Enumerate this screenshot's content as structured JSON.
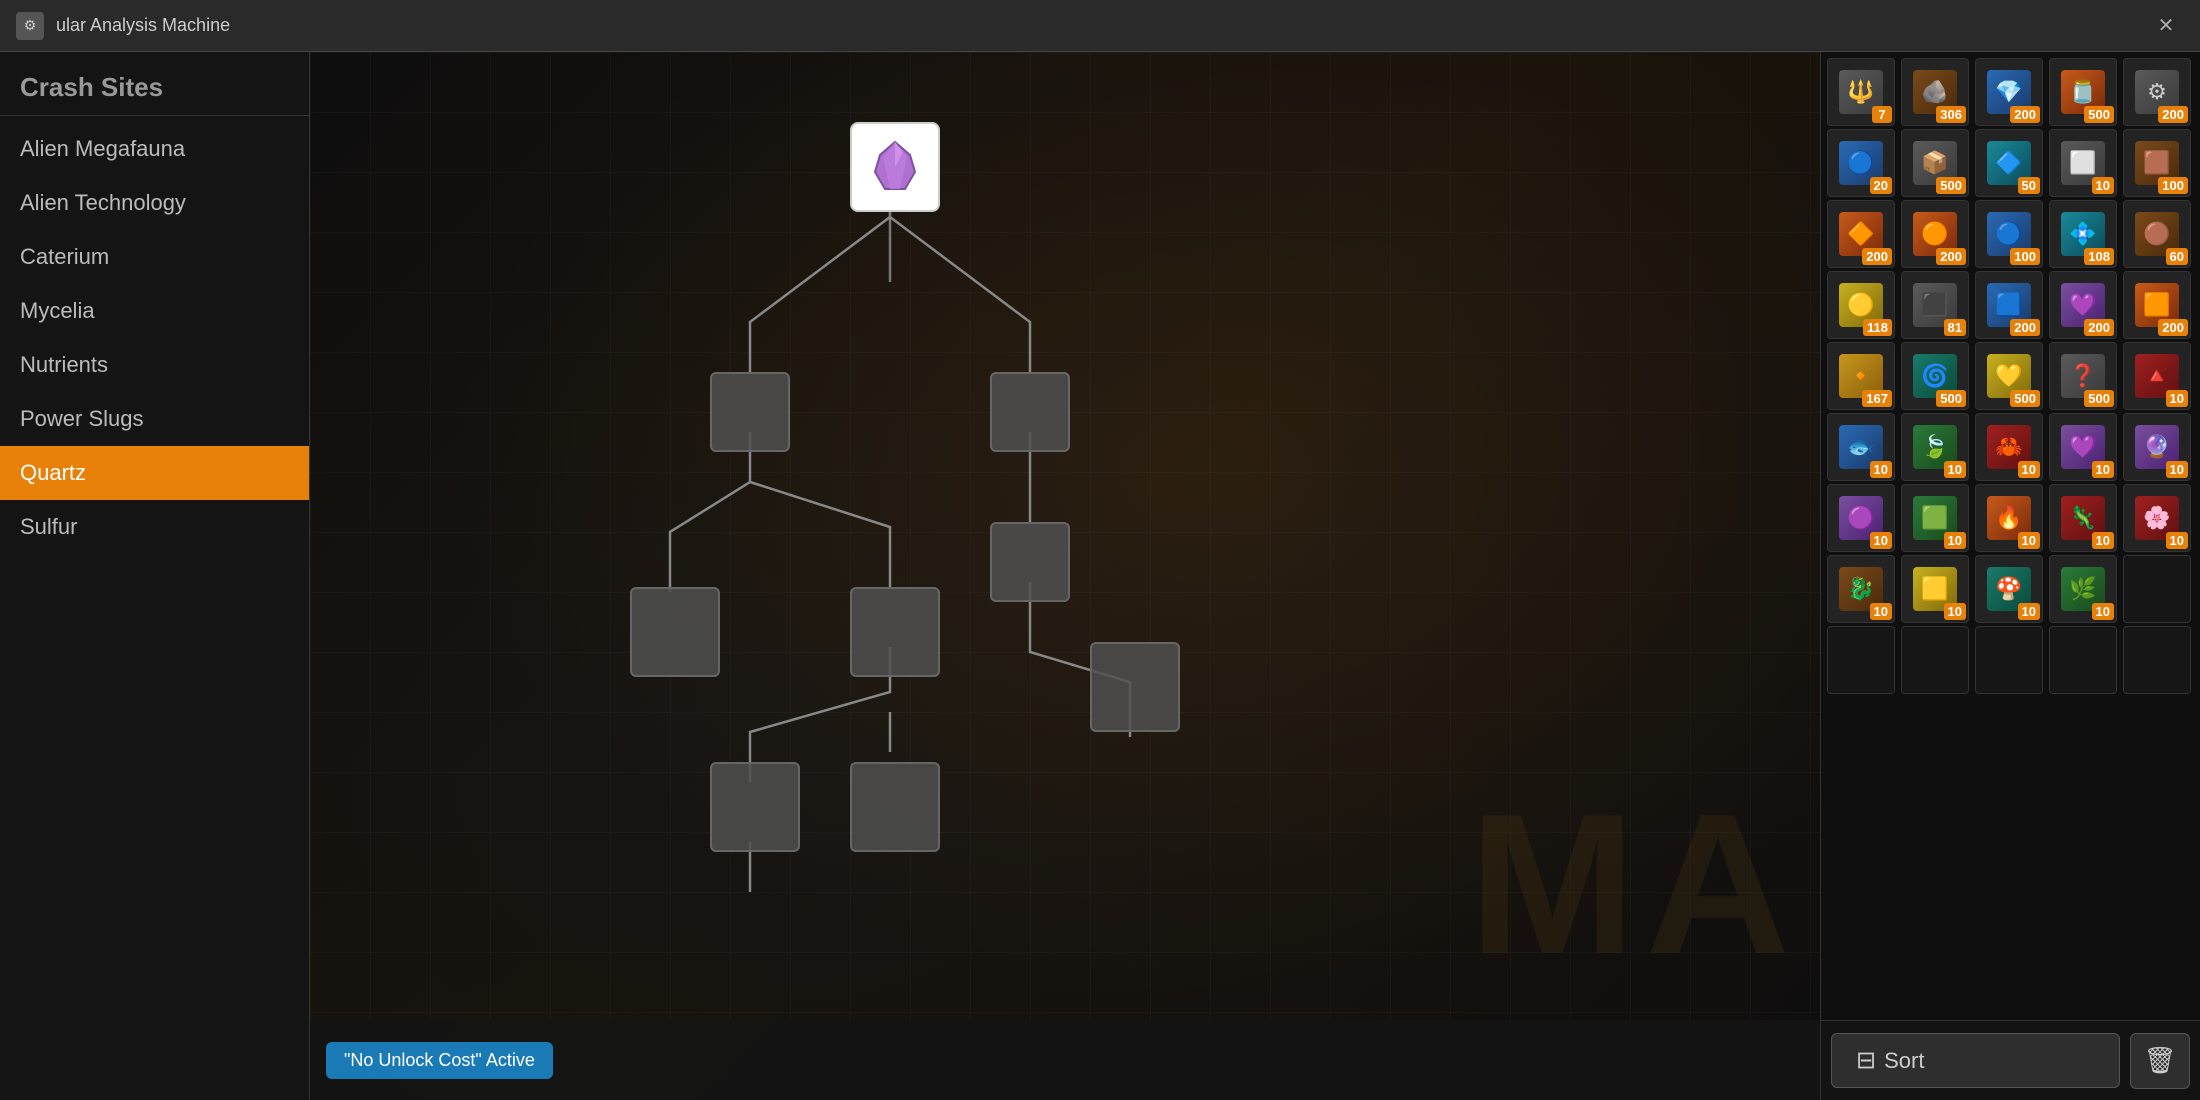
{
  "titlebar": {
    "icon": "⚙",
    "title": "ular Analysis Machine",
    "close_label": "✕"
  },
  "sidebar": {
    "header": "Crash Sites",
    "items": [
      {
        "id": "alien-megafauna",
        "label": "Alien Megafauna",
        "active": false
      },
      {
        "id": "alien-technology",
        "label": "Alien Technology",
        "active": false
      },
      {
        "id": "caterium",
        "label": "Caterium",
        "active": false
      },
      {
        "id": "mycelia",
        "label": "Mycelia",
        "active": false
      },
      {
        "id": "nutrients",
        "label": "Nutrients",
        "active": false
      },
      {
        "id": "power-slugs",
        "label": "Power Slugs",
        "active": false
      },
      {
        "id": "quartz",
        "label": "Quartz",
        "active": true
      },
      {
        "id": "sulfur",
        "label": "Sulfur",
        "active": false
      }
    ]
  },
  "filter_badge": {
    "label": "\"No Unlock Cost\" Active"
  },
  "inventory": {
    "items": [
      {
        "icon": "🔱",
        "count": "7",
        "color": "color-gray"
      },
      {
        "icon": "🪨",
        "count": "306",
        "color": "color-brown"
      },
      {
        "icon": "💎",
        "count": "200",
        "color": "color-blue"
      },
      {
        "icon": "🫙",
        "count": "500",
        "color": "color-orange"
      },
      {
        "icon": "⚙",
        "count": "200",
        "color": "color-gray"
      },
      {
        "icon": "🔵",
        "count": "20",
        "color": "color-blue"
      },
      {
        "icon": "📦",
        "count": "500",
        "color": "color-gray"
      },
      {
        "icon": "🔷",
        "count": "50",
        "color": "color-cyan"
      },
      {
        "icon": "⬜",
        "count": "10",
        "color": "color-gray"
      },
      {
        "icon": "🟫",
        "count": "100",
        "color": "color-brown"
      },
      {
        "icon": "🔶",
        "count": "200",
        "color": "color-orange"
      },
      {
        "icon": "🟠",
        "count": "200",
        "color": "color-orange"
      },
      {
        "icon": "🔵",
        "count": "100",
        "color": "color-blue"
      },
      {
        "icon": "💠",
        "count": "108",
        "color": "color-cyan"
      },
      {
        "icon": "🟤",
        "count": "60",
        "color": "color-brown"
      },
      {
        "icon": "🟡",
        "count": "118",
        "color": "color-yellow"
      },
      {
        "icon": "⬛",
        "count": "81",
        "color": "color-gray"
      },
      {
        "icon": "🟦",
        "count": "200",
        "color": "color-blue"
      },
      {
        "icon": "💜",
        "count": "200",
        "color": "color-purple"
      },
      {
        "icon": "🟧",
        "count": "200",
        "color": "color-orange"
      },
      {
        "icon": "🔸",
        "count": "167",
        "color": "color-gold"
      },
      {
        "icon": "🌀",
        "count": "500",
        "color": "color-teal"
      },
      {
        "icon": "💛",
        "count": "500",
        "color": "color-yellow"
      },
      {
        "icon": "❓",
        "count": "500",
        "color": "color-gray"
      },
      {
        "icon": "🔺",
        "count": "10",
        "color": "color-red"
      },
      {
        "icon": "🐟",
        "count": "10",
        "color": "color-blue"
      },
      {
        "icon": "🍃",
        "count": "10",
        "color": "color-green"
      },
      {
        "icon": "🦀",
        "count": "10",
        "color": "color-red"
      },
      {
        "icon": "💜",
        "count": "10",
        "color": "color-purple"
      },
      {
        "icon": "🔮",
        "count": "10",
        "color": "color-purple"
      },
      {
        "icon": "🟣",
        "count": "10",
        "color": "color-purple"
      },
      {
        "icon": "🟩",
        "count": "10",
        "color": "color-green"
      },
      {
        "icon": "🔥",
        "count": "10",
        "color": "color-orange"
      },
      {
        "icon": "🦎",
        "count": "10",
        "color": "color-red"
      },
      {
        "icon": "🌸",
        "count": "10",
        "color": "color-red"
      },
      {
        "icon": "🐉",
        "count": "10",
        "color": "color-brown"
      },
      {
        "icon": "🟨",
        "count": "10",
        "color": "color-yellow"
      },
      {
        "icon": "🍄",
        "count": "10",
        "color": "color-teal"
      },
      {
        "icon": "🌿",
        "count": "10",
        "color": "color-green"
      },
      {
        "icon": "",
        "count": "",
        "color": ""
      },
      {
        "icon": "",
        "count": "",
        "color": ""
      },
      {
        "icon": "",
        "count": "",
        "color": ""
      },
      {
        "icon": "",
        "count": "",
        "color": ""
      },
      {
        "icon": "",
        "count": "",
        "color": ""
      },
      {
        "icon": "",
        "count": "",
        "color": ""
      }
    ]
  },
  "bottom": {
    "sort_label": "Sort",
    "sort_icon": "≡",
    "trash_icon": "🗑"
  }
}
